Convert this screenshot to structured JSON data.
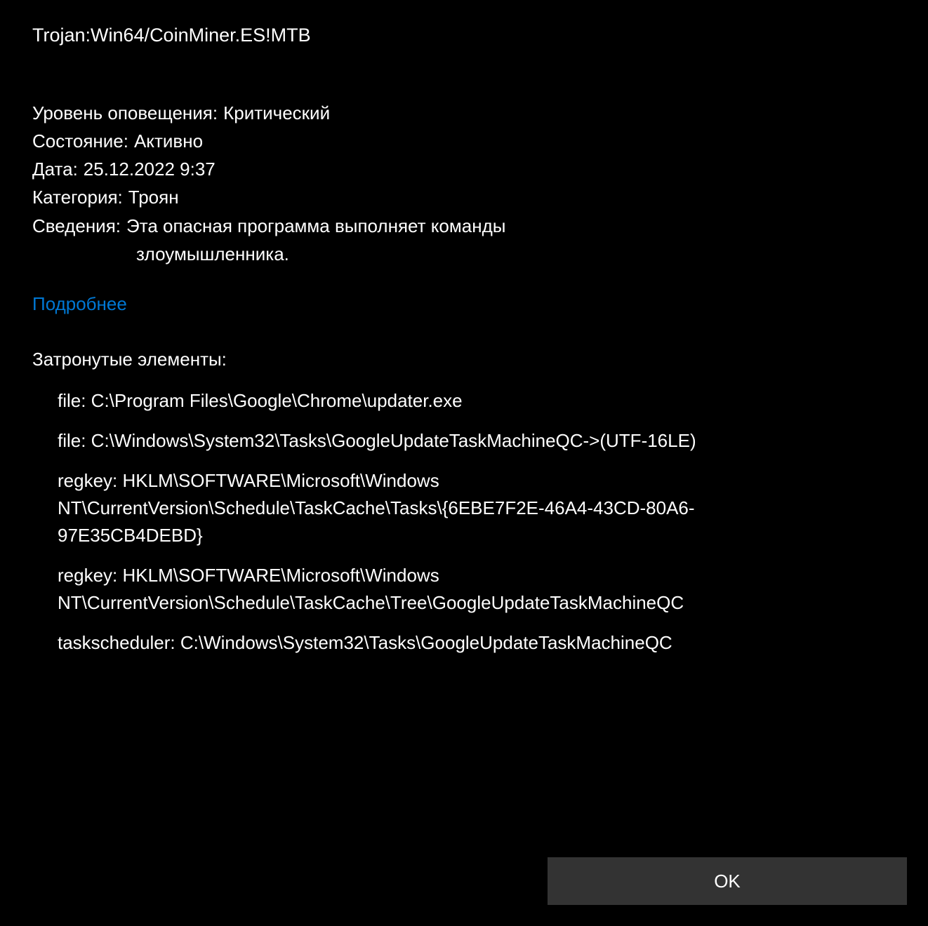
{
  "threat": {
    "name": "Trojan:Win64/CoinMiner.ES!MTB"
  },
  "details": {
    "alert_level_label": "Уровень оповещения:",
    "alert_level_value": "Критический",
    "status_label": "Состояние:",
    "status_value": "Активно",
    "date_label": "Дата:",
    "date_value": "25.12.2022 9:37",
    "category_label": "Категория:",
    "category_value": "Троян",
    "info_label": "Сведения:",
    "info_value_line1": "Эта опасная программа выполняет команды",
    "info_value_line2": "злоумышленника."
  },
  "more_details_link": "Подробнее",
  "affected": {
    "header": "Затронутые элементы:",
    "items": [
      "file: C:\\Program Files\\Google\\Chrome\\updater.exe",
      "file: C:\\Windows\\System32\\Tasks\\GoogleUpdateTaskMachineQC->(UTF-16LE)",
      "regkey: HKLM\\SOFTWARE\\Microsoft\\Windows NT\\CurrentVersion\\Schedule\\TaskCache\\Tasks\\{6EBE7F2E-46A4-43CD-80A6-97E35CB4DEBD}",
      "regkey: HKLM\\SOFTWARE\\Microsoft\\Windows NT\\CurrentVersion\\Schedule\\TaskCache\\Tree\\GoogleUpdateTaskMachineQC",
      "taskscheduler: C:\\Windows\\System32\\Tasks\\GoogleUpdateTaskMachineQC"
    ]
  },
  "buttons": {
    "ok": "OK"
  },
  "colors": {
    "background": "#000000",
    "text": "#ffffff",
    "link": "#0078d4",
    "button_bg": "#333333"
  }
}
